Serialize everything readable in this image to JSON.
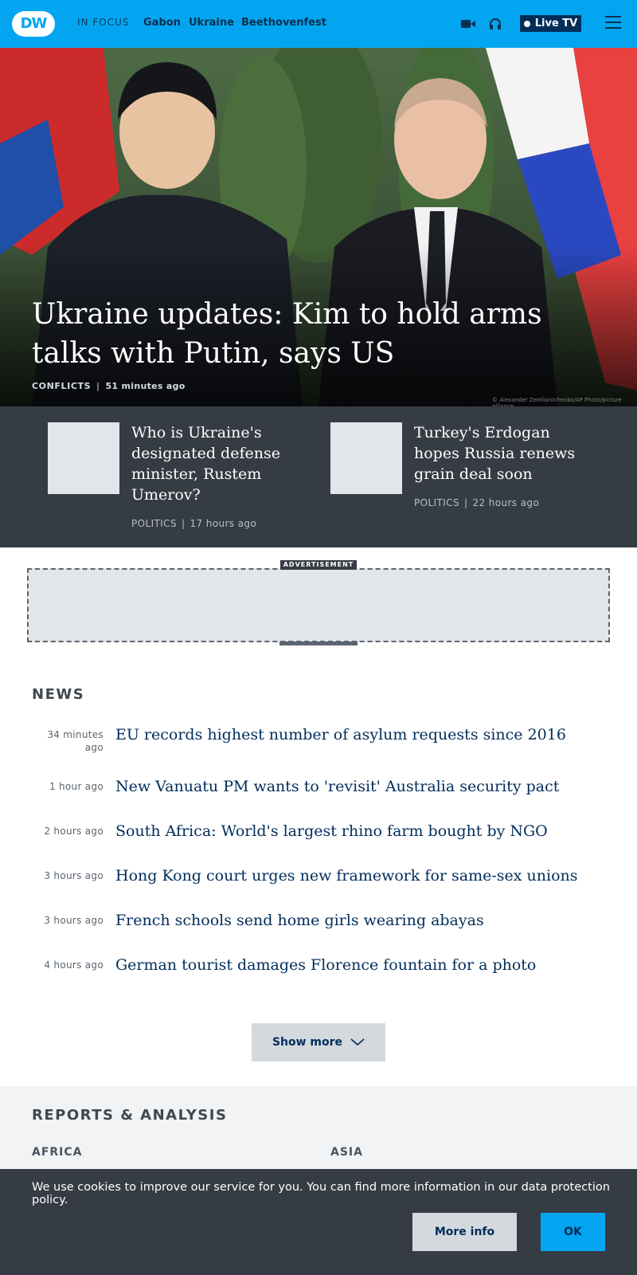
{
  "header": {
    "logo_text": "DW",
    "in_focus_label": "IN FOCUS",
    "nav": [
      "Gabon",
      "Ukraine",
      "Beethovenfest"
    ],
    "icons": [
      "video-camera-icon",
      "headphones-icon",
      "menu-icon"
    ],
    "live_tv_label": "Live TV",
    "brand_color": "#04a5f0"
  },
  "hero": {
    "title": "Ukraine updates: Kim to hold arms talks with Putin, says US",
    "category": "CONFLICTS",
    "time": "51 minutes ago",
    "photo_credit": "© Alexander Zemlianichenko/AP Photo/picture alliance"
  },
  "secondary": [
    {
      "title": "Who is Ukraine's designated defense minister, Rustem Umerov?",
      "category": "POLITICS",
      "time": "17 hours ago"
    },
    {
      "title": "Turkey's Erdogan hopes Russia renews grain deal soon",
      "category": "POLITICS",
      "time": "22 hours ago"
    }
  ],
  "ad": {
    "label": "ADVERTISEMENT"
  },
  "news": {
    "heading": "NEWS",
    "items": [
      {
        "time": "34 minutes ago",
        "title": "EU records highest number of asylum requests since 2016"
      },
      {
        "time": "1 hour ago",
        "title": "New Vanuatu PM wants to 'revisit' Australia security pact"
      },
      {
        "time": "2 hours ago",
        "title": "South Africa: World's largest rhino farm bought by NGO"
      },
      {
        "time": "3 hours ago",
        "title": "Hong Kong court urges new framework for same-sex unions"
      },
      {
        "time": "3 hours ago",
        "title": "French schools send home girls wearing abayas"
      },
      {
        "time": "4 hours ago",
        "title": "German tourist damages Florence fountain for a photo"
      }
    ],
    "show_more_label": "Show more"
  },
  "reports": {
    "heading": "REPORTS & ANALYSIS",
    "regions": [
      "AFRICA",
      "ASIA"
    ]
  },
  "cookie": {
    "text": "We use cookies to improve our service for you. You can find more information in our data protection policy.",
    "more_info_label": "More info",
    "ok_label": "OK"
  }
}
